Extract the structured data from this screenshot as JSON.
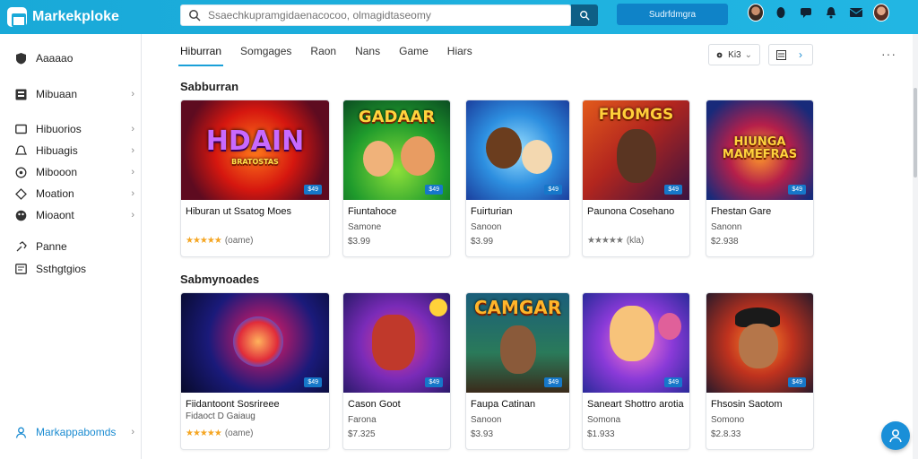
{
  "header": {
    "app_name": "Markekploke",
    "search_placeholder": "Ssaechkupramgidaenacocoo, olmagidtaseomy",
    "primary_button": "Sudrfdmgra"
  },
  "sidebar": {
    "items": [
      {
        "label": "Aaaaao",
        "icon": "shield-icon",
        "chevron": false
      },
      {
        "label": "Mibuaan",
        "icon": "grid-icon",
        "chevron": true
      },
      {
        "label": "Hibuorios",
        "icon": "folder-icon",
        "chevron": true
      },
      {
        "label": "Hibuagis",
        "icon": "bell-icon",
        "chevron": true
      },
      {
        "label": "Mibooon",
        "icon": "headset-icon",
        "chevron": true
      },
      {
        "label": "Moation",
        "icon": "tag-icon",
        "chevron": true
      },
      {
        "label": "Mioaont",
        "icon": "palette-icon",
        "chevron": true
      },
      {
        "label": "Panne",
        "icon": "link-icon",
        "chevron": false
      },
      {
        "label": "Ssthgtgios",
        "icon": "doc-icon",
        "chevron": false
      },
      {
        "label": "Markappabomds",
        "icon": "user-icon",
        "chevron": true
      }
    ]
  },
  "tabs": [
    {
      "label": "Hiburran",
      "active": true
    },
    {
      "label": "Somgages"
    },
    {
      "label": "Raon"
    },
    {
      "label": "Nans"
    },
    {
      "label": "Game"
    },
    {
      "label": "Hiars"
    }
  ],
  "toolbar": {
    "filter_label": "Ki3"
  },
  "sections": [
    {
      "title": "Sabburran",
      "cards": [
        {
          "art": "HDAIN",
          "art_sub": "BRATOSTAS",
          "badge": "$49",
          "name": "Hiburan ut Ssatog Moes",
          "sub": "",
          "rating_text": "(oame)",
          "stars": "★★★★★",
          "price": ""
        },
        {
          "art": "GADAAR",
          "badge": "$49",
          "name": "Fiuntahoce",
          "sub": "Samone",
          "price": "$3.99"
        },
        {
          "art": "",
          "badge": "$49",
          "name": "Fuirturian",
          "sub": "Sanoon",
          "price": "$3.99"
        },
        {
          "art": "FHOMGS",
          "badge": "$49",
          "name": "Paunona Cosehano",
          "sub": "",
          "rating_text": "(kla)",
          "stars": "★★★★★",
          "price": ""
        },
        {
          "art": "HIUNGA MAMEFRAS",
          "badge": "$49",
          "name": "Fhestan Gare",
          "sub": "Sanonn",
          "price": "$2.938"
        }
      ]
    },
    {
      "title": "Sabmynoades",
      "cards": [
        {
          "art": "",
          "badge": "$49",
          "name": "Fiidantoont Sosrireee",
          "sub": "Fidaoct D Gaiaug",
          "rating_text": "(oame)",
          "stars": "★★★★★",
          "price": ""
        },
        {
          "art": "",
          "badge": "$49",
          "name": "Cason Goot",
          "sub": "Farona",
          "price": "$7.325"
        },
        {
          "art": "CAMGAR",
          "badge": "$49",
          "name": "Faupa Catinan",
          "sub": "Sanoon",
          "price": "$3.93"
        },
        {
          "art": "",
          "badge": "$49",
          "name": "Saneart Shottro arotia",
          "sub": "Somona",
          "price": "$1.933"
        },
        {
          "art": "",
          "badge": "$49",
          "name": "Fhsosin Saotom",
          "sub": "Somono",
          "price": "$2.8.33"
        }
      ]
    }
  ],
  "colors": {
    "accent": "#1a8bd1",
    "header": "#19a9d8",
    "star": "#f5a623"
  }
}
